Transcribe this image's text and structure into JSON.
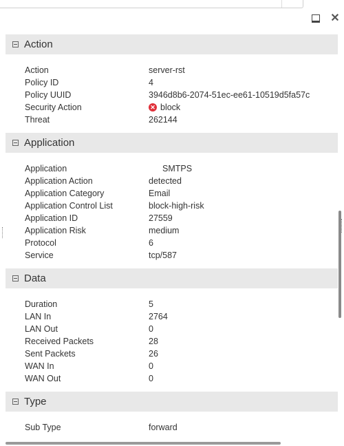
{
  "window_controls": {
    "maximize_icon": "maximize-icon",
    "close_icon": "close-icon",
    "close_glyph": "✕"
  },
  "sections": {
    "action": {
      "title": "Action",
      "rows": [
        {
          "label": "Action",
          "value": "server-rst"
        },
        {
          "label": "Policy ID",
          "value": "4"
        },
        {
          "label": "Policy UUID",
          "value": "3946d8b6-2074-51ec-ee61-10519d5fa57c"
        },
        {
          "label": "Security Action",
          "value": "block",
          "icon": "block-icon"
        },
        {
          "label": "Threat",
          "value": "262144"
        }
      ]
    },
    "application": {
      "title": "Application",
      "rows": [
        {
          "label": "Application",
          "value": "SMTPS"
        },
        {
          "label": "Application Action",
          "value": "detected"
        },
        {
          "label": "Application Category",
          "value": "Email"
        },
        {
          "label": "Application Control List",
          "value": "block-high-risk"
        },
        {
          "label": "Application ID",
          "value": "27559"
        },
        {
          "label": "Application Risk",
          "value": "medium"
        },
        {
          "label": "Protocol",
          "value": "6"
        },
        {
          "label": "Service",
          "value": "tcp/587"
        }
      ]
    },
    "data": {
      "title": "Data",
      "rows": [
        {
          "label": "Duration",
          "value": "5"
        },
        {
          "label": "LAN In",
          "value": "2764"
        },
        {
          "label": "LAN Out",
          "value": "0"
        },
        {
          "label": "Received Packets",
          "value": "28"
        },
        {
          "label": "Sent Packets",
          "value": "26"
        },
        {
          "label": "WAN In",
          "value": "0"
        },
        {
          "label": "WAN Out",
          "value": "0"
        }
      ]
    },
    "type": {
      "title": "Type",
      "rows": [
        {
          "label": "Sub Type",
          "value": "forward"
        }
      ]
    }
  },
  "colors": {
    "header_bg": "#e8e8e8",
    "block_red": "#e0303a"
  }
}
